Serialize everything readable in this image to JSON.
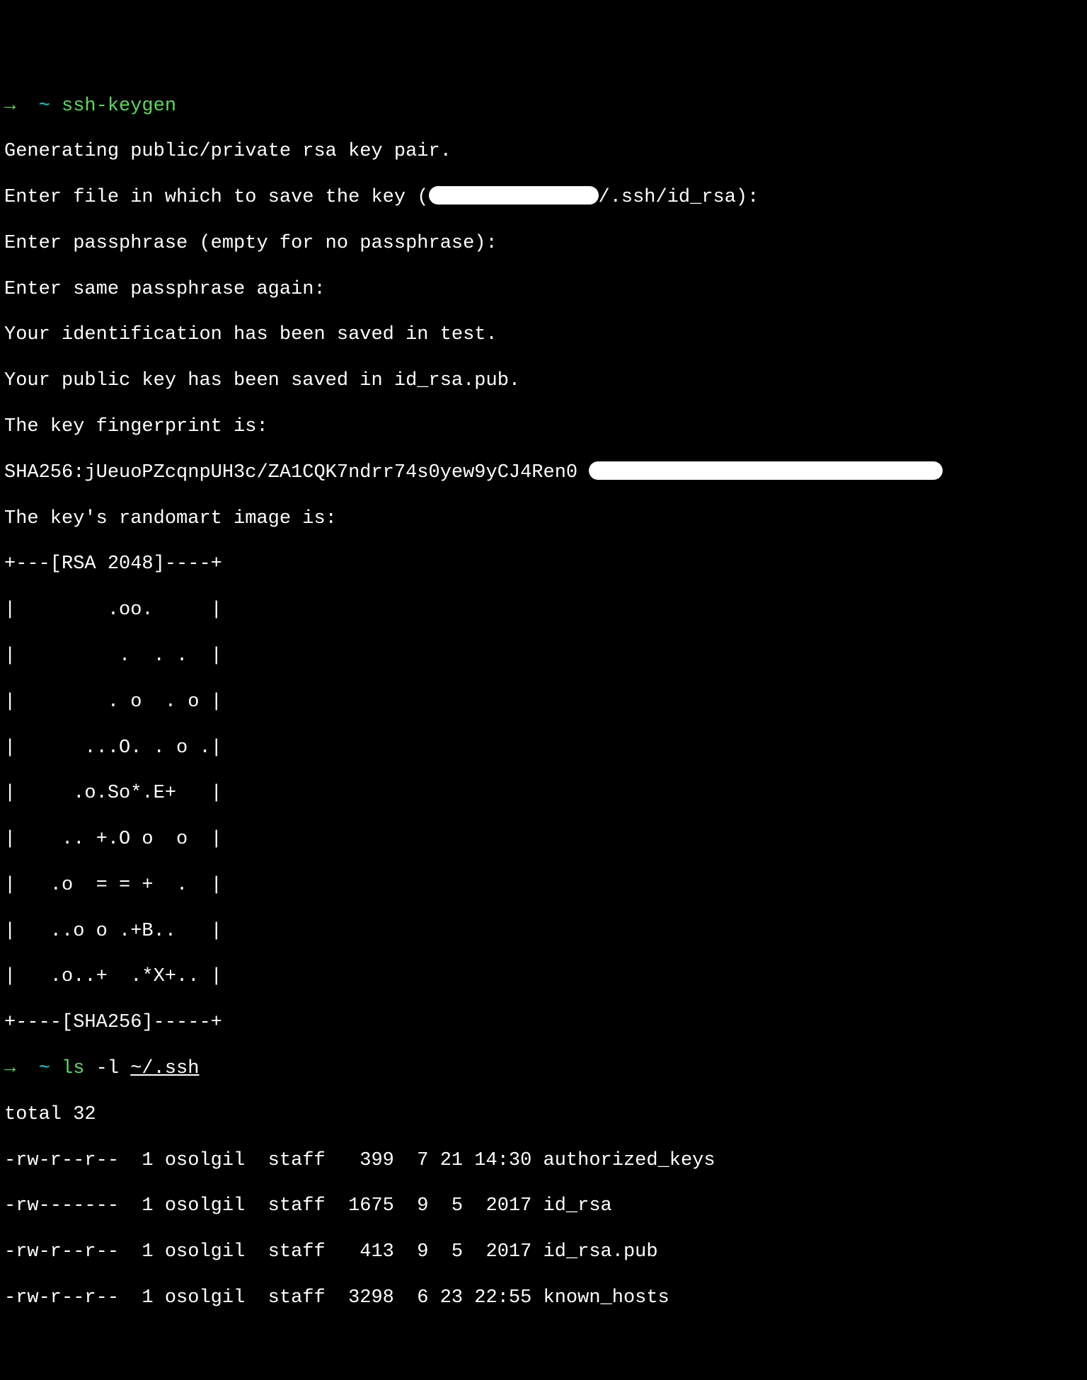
{
  "prompt1": {
    "arrow": "→  ",
    "tilde": "~ ",
    "cmd": "ssh-keygen"
  },
  "out": {
    "l1": "Generating public/private rsa key pair.",
    "l2a": "Enter file in which to save the key (",
    "l2b": "/.ssh/id_rsa):",
    "l3": "Enter passphrase (empty for no passphrase):",
    "l4": "Enter same passphrase again:",
    "l5": "Your identification has been saved in test.",
    "l6": "Your public key has been saved in id_rsa.pub.",
    "l7": "The key fingerprint is:",
    "l8a": "SHA256:jUeuoPZcqnpUH3c/ZA1CQK7ndrr74s0yew9yCJ4Ren0 ",
    "l9": "The key's randomart image is:",
    "art0": "+---[RSA 2048]----+",
    "art1": "|        .oo.     |",
    "art2": "|         .  . .  |",
    "art3": "|        . o  . o |",
    "art4": "|      ...O. . o .|",
    "art5": "|     .o.So*.E+   |",
    "art6": "|    .. +.O o  o  |",
    "art7": "|   .o  = = +  .  |",
    "art8": "|   ..o o .+B..   |",
    "art9": "|   .o..+  .*X+.. |",
    "art10": "+----[SHA256]-----+"
  },
  "prompt2": {
    "arrow": "→  ",
    "tilde": "~ ",
    "cmd": "ls",
    "flag": " -l ",
    "path": "~/.ssh"
  },
  "ls": {
    "total": "total 32",
    "r1": "-rw-r--r--  1 osolgil  staff   399  7 21 14:30 authorized_keys",
    "r2": "-rw-------  1 osolgil  staff  1675  9  5  2017 id_rsa",
    "r3": "-rw-r--r--  1 osolgil  staff   413  9  5  2017 id_rsa.pub",
    "r4": "-rw-r--r--  1 osolgil  staff  3298  6 23 22:55 known_hosts"
  }
}
